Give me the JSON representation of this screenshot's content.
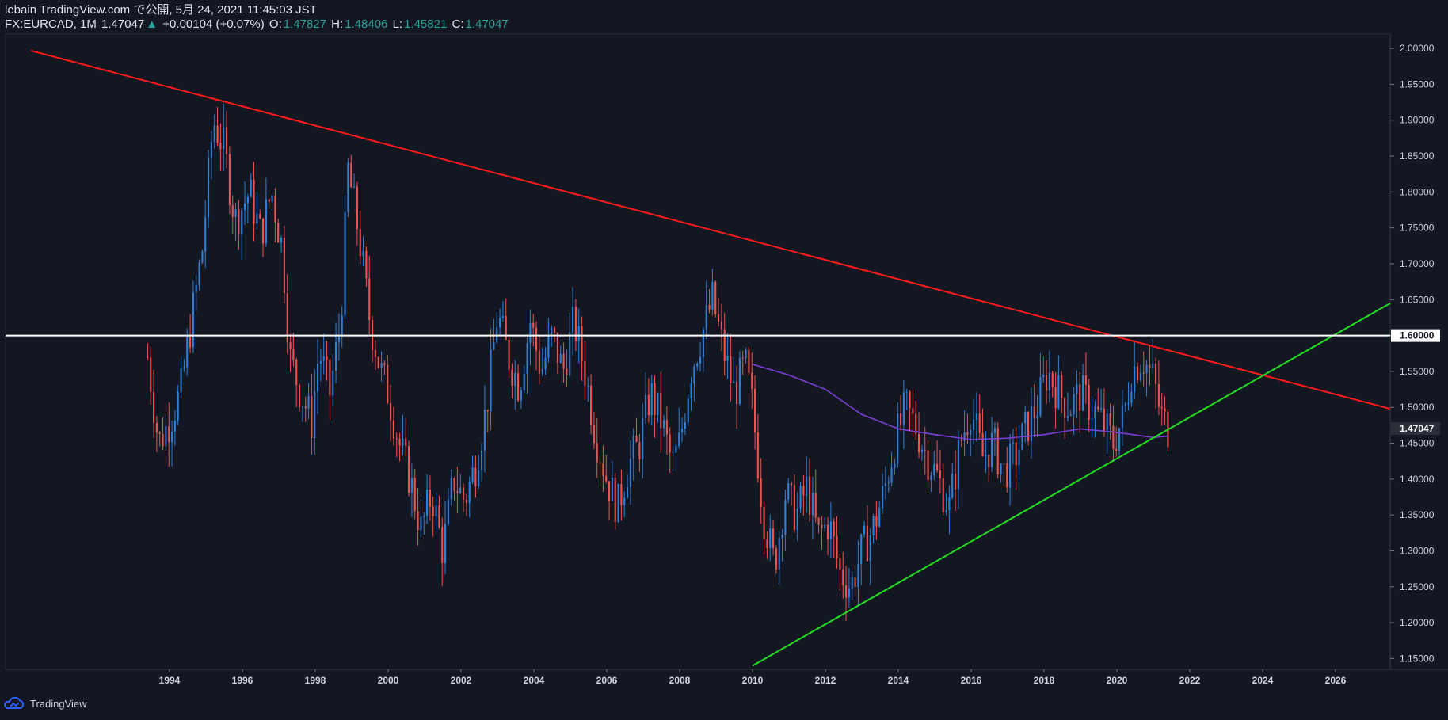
{
  "header": {
    "line1": "lebain TradingView.com で公開, 5月 24, 2021 11:45:03 JST",
    "symbol": "FX:EURCAD, 1M",
    "last": "1.47047",
    "change_arrow": "▲",
    "change": "+0.00104 (+0.07%)",
    "o_label": "O:",
    "o_value": "1.47827",
    "h_label": "H:",
    "h_value": "1.48406",
    "l_label": "L:",
    "l_value": "1.45821",
    "c_label": "C:",
    "c_value": "1.47047"
  },
  "footer": {
    "brand": "TradingView"
  },
  "colors": {
    "background": "#131722",
    "up_candle": "#2f7fd8",
    "down_candle": "#ef5350",
    "resistance_line": "#ff1a1a",
    "support_line": "#22dd22",
    "horizontal_level": "#ffffff",
    "moving_average": "#7b3fd6"
  },
  "chart_data": {
    "type": "candlestick",
    "symbol": "FX:EURCAD",
    "interval": "1M",
    "x_ticks": [
      "1994",
      "1996",
      "1998",
      "2000",
      "2002",
      "2004",
      "2006",
      "2008",
      "2010",
      "2012",
      "2014",
      "2016",
      "2018",
      "2020",
      "2022",
      "2024",
      "2026"
    ],
    "y_ticks": [
      "1.15000",
      "1.20000",
      "1.25000",
      "1.30000",
      "1.35000",
      "1.40000",
      "1.45000",
      "1.50000",
      "1.55000",
      "1.60000",
      "1.65000",
      "1.70000",
      "1.75000",
      "1.80000",
      "1.85000",
      "1.90000",
      "1.95000",
      "2.00000"
    ],
    "ylim": [
      1.135,
      2.02
    ],
    "xlim": [
      1989.5,
      2027.5
    ],
    "price_path": [
      [
        1993.4,
        1.57
      ],
      [
        1993.7,
        1.45
      ],
      [
        1994.0,
        1.48
      ],
      [
        1994.3,
        1.52
      ],
      [
        1994.6,
        1.62
      ],
      [
        1994.9,
        1.72
      ],
      [
        1995.2,
        1.9
      ],
      [
        1995.5,
        1.86
      ],
      [
        1995.8,
        1.76
      ],
      [
        1996.2,
        1.8
      ],
      [
        1996.5,
        1.74
      ],
      [
        1996.8,
        1.8
      ],
      [
        1997.1,
        1.72
      ],
      [
        1997.3,
        1.57
      ],
      [
        1997.6,
        1.52
      ],
      [
        1997.9,
        1.48
      ],
      [
        1998.1,
        1.58
      ],
      [
        1998.4,
        1.52
      ],
      [
        1998.7,
        1.62
      ],
      [
        1998.9,
        1.83
      ],
      [
        1999.2,
        1.74
      ],
      [
        1999.5,
        1.62
      ],
      [
        1999.8,
        1.55
      ],
      [
        2000.0,
        1.52
      ],
      [
        2000.3,
        1.45
      ],
      [
        2000.6,
        1.4
      ],
      [
        2000.9,
        1.33
      ],
      [
        2001.2,
        1.38
      ],
      [
        2001.5,
        1.3
      ],
      [
        2001.8,
        1.4
      ],
      [
        2002.1,
        1.37
      ],
      [
        2002.4,
        1.42
      ],
      [
        2002.7,
        1.5
      ],
      [
        2003.0,
        1.63
      ],
      [
        2003.3,
        1.57
      ],
      [
        2003.6,
        1.53
      ],
      [
        2003.9,
        1.62
      ],
      [
        2004.2,
        1.55
      ],
      [
        2004.5,
        1.6
      ],
      [
        2004.8,
        1.55
      ],
      [
        2005.1,
        1.62
      ],
      [
        2005.4,
        1.55
      ],
      [
        2005.7,
        1.46
      ],
      [
        2006.0,
        1.4
      ],
      [
        2006.3,
        1.36
      ],
      [
        2006.6,
        1.42
      ],
      [
        2006.9,
        1.45
      ],
      [
        2007.2,
        1.52
      ],
      [
        2007.5,
        1.48
      ],
      [
        2007.8,
        1.42
      ],
      [
        2008.0,
        1.45
      ],
      [
        2008.3,
        1.55
      ],
      [
        2008.6,
        1.6
      ],
      [
        2008.9,
        1.65
      ],
      [
        2009.2,
        1.58
      ],
      [
        2009.5,
        1.52
      ],
      [
        2009.8,
        1.56
      ],
      [
        2010.0,
        1.5
      ],
      [
        2010.3,
        1.35
      ],
      [
        2010.6,
        1.28
      ],
      [
        2010.9,
        1.38
      ],
      [
        2011.2,
        1.35
      ],
      [
        2011.5,
        1.39
      ],
      [
        2011.8,
        1.32
      ],
      [
        2012.1,
        1.34
      ],
      [
        2012.4,
        1.27
      ],
      [
        2012.7,
        1.25
      ],
      [
        2013.0,
        1.3
      ],
      [
        2013.3,
        1.33
      ],
      [
        2013.6,
        1.38
      ],
      [
        2013.9,
        1.45
      ],
      [
        2014.2,
        1.5
      ],
      [
        2014.5,
        1.47
      ],
      [
        2014.8,
        1.43
      ],
      [
        2015.1,
        1.4
      ],
      [
        2015.4,
        1.36
      ],
      [
        2015.7,
        1.45
      ],
      [
        2016.0,
        1.5
      ],
      [
        2016.3,
        1.43
      ],
      [
        2016.6,
        1.45
      ],
      [
        2016.9,
        1.41
      ],
      [
        2017.2,
        1.43
      ],
      [
        2017.5,
        1.47
      ],
      [
        2017.8,
        1.5
      ],
      [
        2018.1,
        1.55
      ],
      [
        2018.4,
        1.52
      ],
      [
        2018.7,
        1.5
      ],
      [
        2019.0,
        1.52
      ],
      [
        2019.3,
        1.5
      ],
      [
        2019.6,
        1.48
      ],
      [
        2019.9,
        1.45
      ],
      [
        2020.2,
        1.49
      ],
      [
        2020.4,
        1.55
      ],
      [
        2020.7,
        1.57
      ],
      [
        2021.0,
        1.54
      ],
      [
        2021.2,
        1.49
      ],
      [
        2021.4,
        1.47
      ]
    ],
    "moving_average": [
      [
        2010.0,
        1.56
      ],
      [
        2011.0,
        1.545
      ],
      [
        2012.0,
        1.525
      ],
      [
        2013.0,
        1.49
      ],
      [
        2014.0,
        1.47
      ],
      [
        2015.0,
        1.462
      ],
      [
        2016.0,
        1.455
      ],
      [
        2017.0,
        1.457
      ],
      [
        2018.0,
        1.462
      ],
      [
        2019.0,
        1.47
      ],
      [
        2020.0,
        1.465
      ],
      [
        2021.0,
        1.458
      ],
      [
        2021.4,
        1.46
      ]
    ],
    "trendlines": [
      {
        "name": "resistance",
        "color": "#ff1a1a",
        "from": [
          1994.6,
          1.938
        ],
        "to": [
          2027.5,
          1.498
        ]
      },
      {
        "name": "support",
        "color": "#22dd22",
        "from": [
          2010.0,
          1.14
        ],
        "to": [
          2027.5,
          1.645
        ]
      },
      {
        "name": "horizontal",
        "color": "#ffffff",
        "from": [
          1989.5,
          1.6
        ],
        "to": [
          2027.5,
          1.6
        ]
      }
    ],
    "price_labels": [
      {
        "value": "1.60000",
        "y": 1.6,
        "style": "white"
      },
      {
        "value": "1.47047",
        "y": 1.47047,
        "style": "dark"
      }
    ]
  }
}
